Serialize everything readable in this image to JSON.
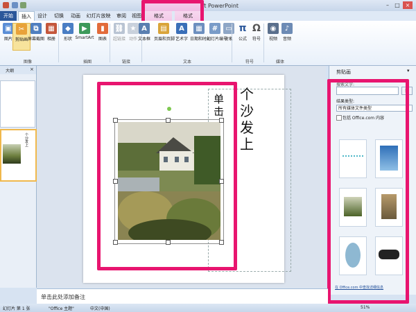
{
  "window": {
    "title": "演示文稿1 - Microsoft PowerPoint"
  },
  "ribbon_tabs": [
    "开始",
    "插入",
    "设计",
    "切换",
    "动画",
    "幻灯片放映",
    "审阅",
    "视图",
    "格式",
    "格式"
  ],
  "active_tab": "插入",
  "ribbon": {
    "buttons": {
      "picture": "图片",
      "clipart": "剪贴画",
      "screenshot": "屏幕截图",
      "album": "相册",
      "shapes": "形状",
      "smartart": "SmartArt",
      "chart": "图表",
      "hyperlink": "超链接",
      "action": "动作",
      "textbox": "文本框",
      "headerfooter": "页眉和页脚",
      "wordart": "艺术字",
      "datetime": "日期和时间",
      "slidenumber": "幻灯片编号",
      "object": "对象",
      "equation": "公式",
      "symbol": "符号",
      "video": "视频",
      "audio": "音频"
    },
    "groups": {
      "images": "图像",
      "illustrations": "插图",
      "links": "链接",
      "text": "文本",
      "symbols": "符号",
      "media": "媒体"
    }
  },
  "left_pane": {
    "tab_label": "大纲",
    "close": "×"
  },
  "slide": {
    "vertical_text_1": "个沙发上",
    "vertical_text_2": "单击"
  },
  "clip_pane": {
    "title": "剪贴画",
    "search_label": "搜索文字:",
    "search_value": "",
    "search_button": "搜",
    "results_label": "结果类型:",
    "results_value": "所有媒体文件类型",
    "include_checkbox": "包括 Office.com 内容",
    "footer_link": "在 Office.com 中查找详细信息"
  },
  "notes": {
    "placeholder": "单击此处添加备注"
  },
  "status": {
    "slide": "幻灯片 第 1 张",
    "theme": "\"Office 主题\"",
    "lang": "中文(中国)",
    "zoom": "51%"
  }
}
